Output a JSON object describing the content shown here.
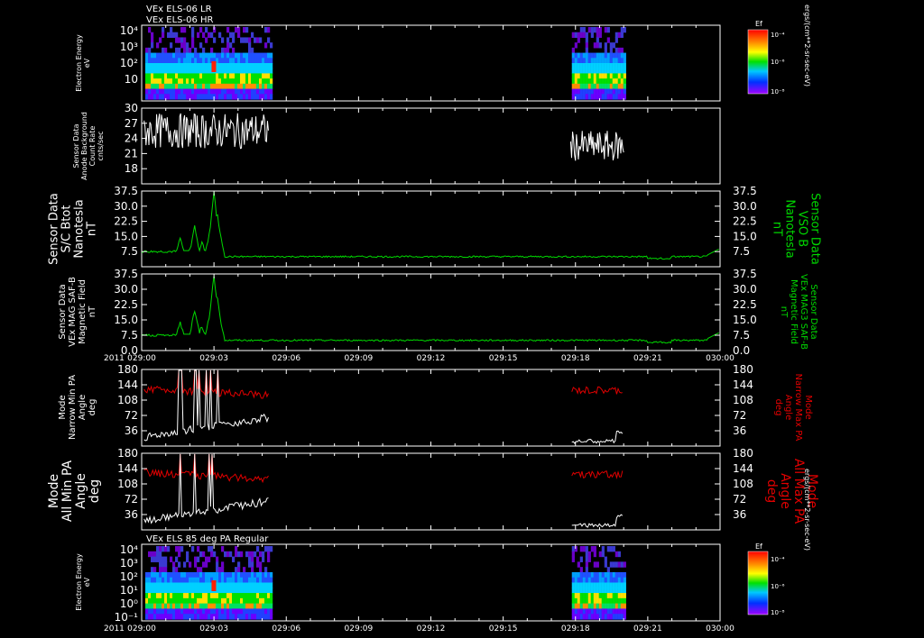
{
  "header": {
    "titles": [
      "VEx ELS-06 LR",
      "VEx ELS-06 HR"
    ]
  },
  "time_axis": {
    "year": "2011",
    "ticks": [
      "029:00",
      "029:03",
      "029:06",
      "029:09",
      "029:12",
      "029:15",
      "029:18",
      "029:21",
      "030:00"
    ]
  },
  "chart_data": [
    {
      "type": "heatmap",
      "id": "spectrogram-top",
      "ylabel": [
        "Electron Energy",
        "eV"
      ],
      "ylabels_ticks": [
        "10⁴",
        "10³",
        "10²",
        "10"
      ],
      "y_scale": "log",
      "colorbar": {
        "title": "Ef",
        "unit_label": "ergs/(cm**2-sr-sec-eV)",
        "ticks": [
          "10⁻⁴",
          "10⁻⁶",
          "10⁻⁸"
        ]
      },
      "data_intervals": [
        [
          "029:00",
          "029:05.4"
        ],
        [
          "029:17.8",
          "029:20.0"
        ]
      ]
    },
    {
      "type": "line",
      "id": "anode-bg",
      "ylabel": [
        "Sensor Data",
        "Anode Background",
        "Count Rate",
        "cnts/sec"
      ],
      "yticks": [
        "30",
        "27",
        "24",
        "21",
        "18"
      ],
      "ylim": [
        15,
        30
      ],
      "color": "#ffffff",
      "series": [
        {
          "segment": 1,
          "x_start": 0.1,
          "x_end": 5.3,
          "mean": 25.5,
          "jitter": 3.5
        },
        {
          "segment": 2,
          "x_start": 17.8,
          "x_end": 20.0,
          "mean": 22.5,
          "jitter": 3.0
        }
      ]
    },
    {
      "type": "line",
      "id": "btot",
      "ylabel": [
        "Sensor Data",
        "S/C Btot",
        "Nanotesla",
        "nT"
      ],
      "rlabel": [
        "Sensor Data",
        "VSO B",
        "Nanotesla",
        "nT"
      ],
      "yticks": [
        "37.5",
        "30.0",
        "22.5",
        "15.0",
        "7.5"
      ],
      "ylim": [
        0,
        37.5
      ],
      "color": "#00d800",
      "baseline": 5.0,
      "spikes": [
        [
          1.6,
          14
        ],
        [
          2.2,
          20
        ],
        [
          2.5,
          12
        ],
        [
          2.85,
          19
        ],
        [
          3.0,
          37
        ],
        [
          3.15,
          25
        ],
        [
          3.3,
          6
        ]
      ]
    },
    {
      "type": "line",
      "id": "mag-safb",
      "ylabel": [
        "Sensor Data",
        "VEx MAG SAF-B",
        "Magnetic Field",
        "nT"
      ],
      "rlabel": [
        "Sensor Data",
        "VEx MAG3 SAF-B",
        "Magnetic Field",
        "nT"
      ],
      "yticks": [
        "37.5",
        "30.0",
        "22.5",
        "15.0",
        "7.5",
        "0.0"
      ],
      "ylim": [
        0,
        37.5
      ],
      "color": "#00d800",
      "baseline": 5.0
    },
    {
      "type": "line",
      "id": "narrow-pa",
      "ylabel": [
        "Mode",
        "Narrow Min PA",
        "Angle",
        "deg"
      ],
      "rlabel": [
        "Mode",
        "Narrow Max PA",
        "Angle",
        "deg"
      ],
      "yticks": [
        "180",
        "144",
        "108",
        "72",
        "36"
      ],
      "ylim": [
        0,
        180
      ],
      "series": [
        {
          "name": "max",
          "color": "#e00000"
        },
        {
          "name": "min",
          "color": "#ffffff"
        }
      ]
    },
    {
      "type": "line",
      "id": "all-pa",
      "ylabel": [
        "Mode",
        "All Min PA",
        "Angle",
        "deg"
      ],
      "rlabel": [
        "Mode",
        "All Max PA",
        "Angle",
        "deg"
      ],
      "yticks": [
        "180",
        "144",
        "108",
        "72",
        "36"
      ],
      "ylim": [
        0,
        180
      ],
      "series": [
        {
          "name": "max",
          "color": "#e00000"
        },
        {
          "name": "min",
          "color": "#ffffff"
        }
      ]
    },
    {
      "type": "heatmap",
      "id": "spectrogram-bottom",
      "title": "VEx ELS 85 deg PA Regular",
      "ylabel": [
        "Electron Energy",
        "eV"
      ],
      "ylabels_ticks": [
        "10⁴",
        "10³",
        "10²",
        "10¹",
        "10⁰",
        "10⁻¹"
      ],
      "y_scale": "log",
      "colorbar": {
        "title": "Ef",
        "unit_label": "ergs/(cm**2-sr-sec-eV)",
        "ticks": [
          "10⁻⁴",
          "10⁻⁶",
          "10⁻⁸"
        ]
      }
    }
  ],
  "colors": {
    "background": "#000000",
    "axis": "#ffffff",
    "green": "#00d800",
    "red": "#e00000"
  }
}
